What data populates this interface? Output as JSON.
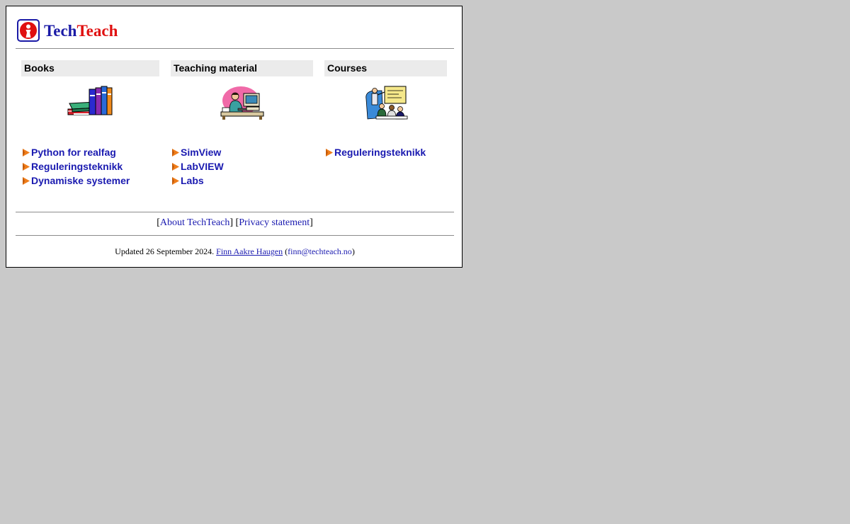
{
  "logo": {
    "text_part1": "Tech",
    "text_part2": "Teach",
    "icon": "techteach-logo-icon",
    "colors": {
      "tech": "#1a1aa6",
      "teach": "#e01010"
    }
  },
  "columns": {
    "books": {
      "header": "Books",
      "image_icon": "books-illustration",
      "links": [
        "Python for realfag",
        "Reguleringsteknikk",
        "Dynamiske systemer"
      ]
    },
    "teaching": {
      "header": "Teaching material",
      "image_icon": "person-at-computer-illustration",
      "links": [
        "SimView",
        "LabVIEW",
        "Labs"
      ]
    },
    "courses": {
      "header": "Courses",
      "image_icon": "classroom-lecture-illustration",
      "links": [
        "Reguleringsteknikk"
      ]
    }
  },
  "footer": {
    "about_label": "About TechTeach",
    "privacy_label": "Privacy statement",
    "updated_prefix": "Updated 26 September 2024.",
    "author": "Finn Aakre Haugen",
    "email": "finn@techteach.no"
  },
  "colors": {
    "page_background": "#c9c9c9",
    "link": "#1a1ab0",
    "header_background": "#ebebeb",
    "bullet": "#ef7d1a"
  }
}
